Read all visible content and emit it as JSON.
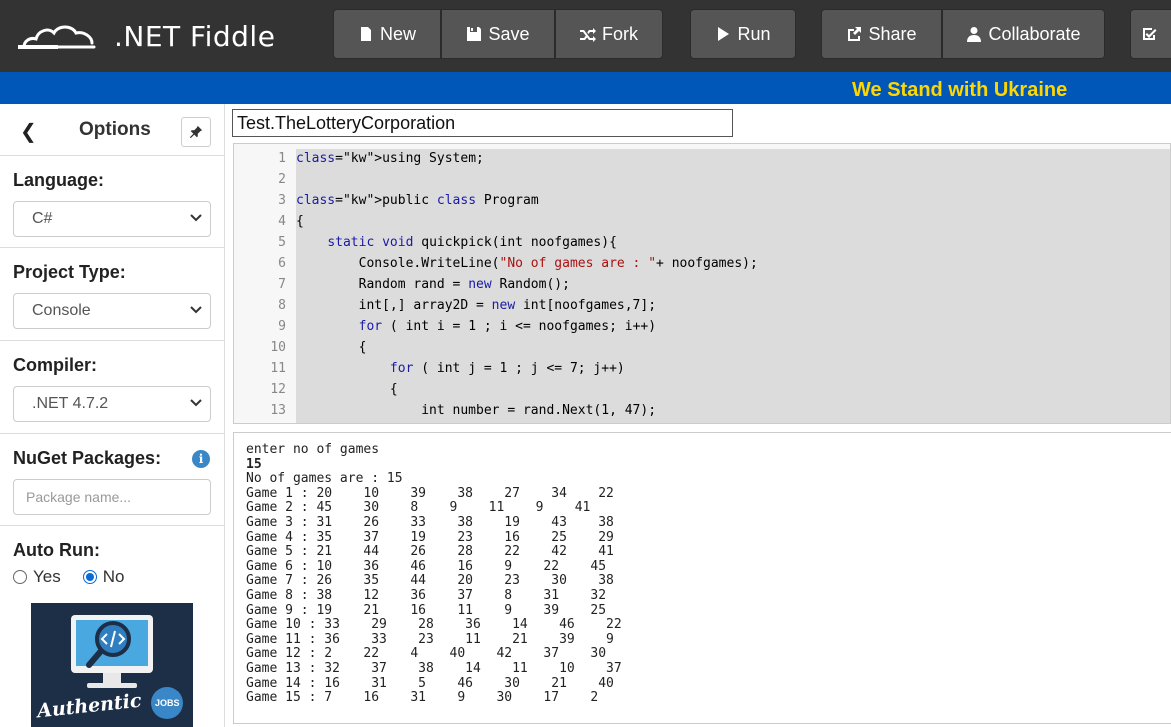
{
  "app": {
    "title": ".NET Fiddle",
    "banner": "We Stand with Ukraine",
    "colors": {
      "topbar": "#333333",
      "button": "#555555",
      "banner": "#0057b7",
      "banner_text": "#ffd700",
      "accent": "#0a6ad8"
    }
  },
  "toolbar": {
    "new_label": "New",
    "save_label": "Save",
    "fork_label": "Fork",
    "run_label": "Run",
    "share_label": "Share",
    "collaborate_label": "Collaborate"
  },
  "sidebar": {
    "title": "Options",
    "language": {
      "label": "Language:",
      "value": "C#"
    },
    "project_type": {
      "label": "Project Type:",
      "value": "Console"
    },
    "compiler": {
      "label": "Compiler:",
      "value": ".NET 4.7.2"
    },
    "nuget": {
      "label": "NuGet Packages:",
      "placeholder": "Package name..."
    },
    "auto_run": {
      "label": "Auto Run:",
      "yes": "Yes",
      "no": "No",
      "selected": "No"
    },
    "ad": {
      "brand": "Authentic",
      "badge": "JOBS"
    }
  },
  "fiddle_name": "Test.TheLotteryCorporation",
  "editor": {
    "lines": [
      "using System;",
      "",
      "public class Program",
      "{",
      "    static void quickpick(int noofgames){",
      "        Console.WriteLine(\"No of games are : \"+ noofgames);",
      "        Random rand = new Random();",
      "        int[,] array2D = new int[noofgames,7];",
      "        for ( int i = 1 ; i <= noofgames; i++)",
      "        {",
      "            for ( int j = 1 ; j <= 7; j++)",
      "            {",
      "                int number = rand.Next(1, 47);"
    ]
  },
  "output": {
    "lines": [
      {
        "text": "enter no of games",
        "bold": false
      },
      {
        "text": "15",
        "bold": true
      },
      {
        "text": "No of games are : 15",
        "bold": false
      },
      {
        "text": "Game 1 : 20    10    39    38    27    34    22",
        "bold": false
      },
      {
        "text": "Game 2 : 45    30    8    9    11    9    41",
        "bold": false
      },
      {
        "text": "Game 3 : 31    26    33    38    19    43    38",
        "bold": false
      },
      {
        "text": "Game 4 : 35    37    19    23    16    25    29",
        "bold": false
      },
      {
        "text": "Game 5 : 21    44    26    28    22    42    41",
        "bold": false
      },
      {
        "text": "Game 6 : 10    36    46    16    9    22    45",
        "bold": false
      },
      {
        "text": "Game 7 : 26    35    44    20    23    30    38",
        "bold": false
      },
      {
        "text": "Game 8 : 38    12    36    37    8    31    32",
        "bold": false
      },
      {
        "text": "Game 9 : 19    21    16    11    9    39    25",
        "bold": false
      },
      {
        "text": "Game 10 : 33    29    28    36    14    46    22",
        "bold": false
      },
      {
        "text": "Game 11 : 36    33    23    11    21    39    9",
        "bold": false
      },
      {
        "text": "Game 12 : 2    22    4    40    42    37    30",
        "bold": false
      },
      {
        "text": "Game 13 : 32    37    38    14    11    10    37",
        "bold": false
      },
      {
        "text": "Game 14 : 16    31    5    46    30    21    40",
        "bold": false
      },
      {
        "text": "Game 15 : 7    16    31    9    30    17    2",
        "bold": false
      }
    ]
  }
}
